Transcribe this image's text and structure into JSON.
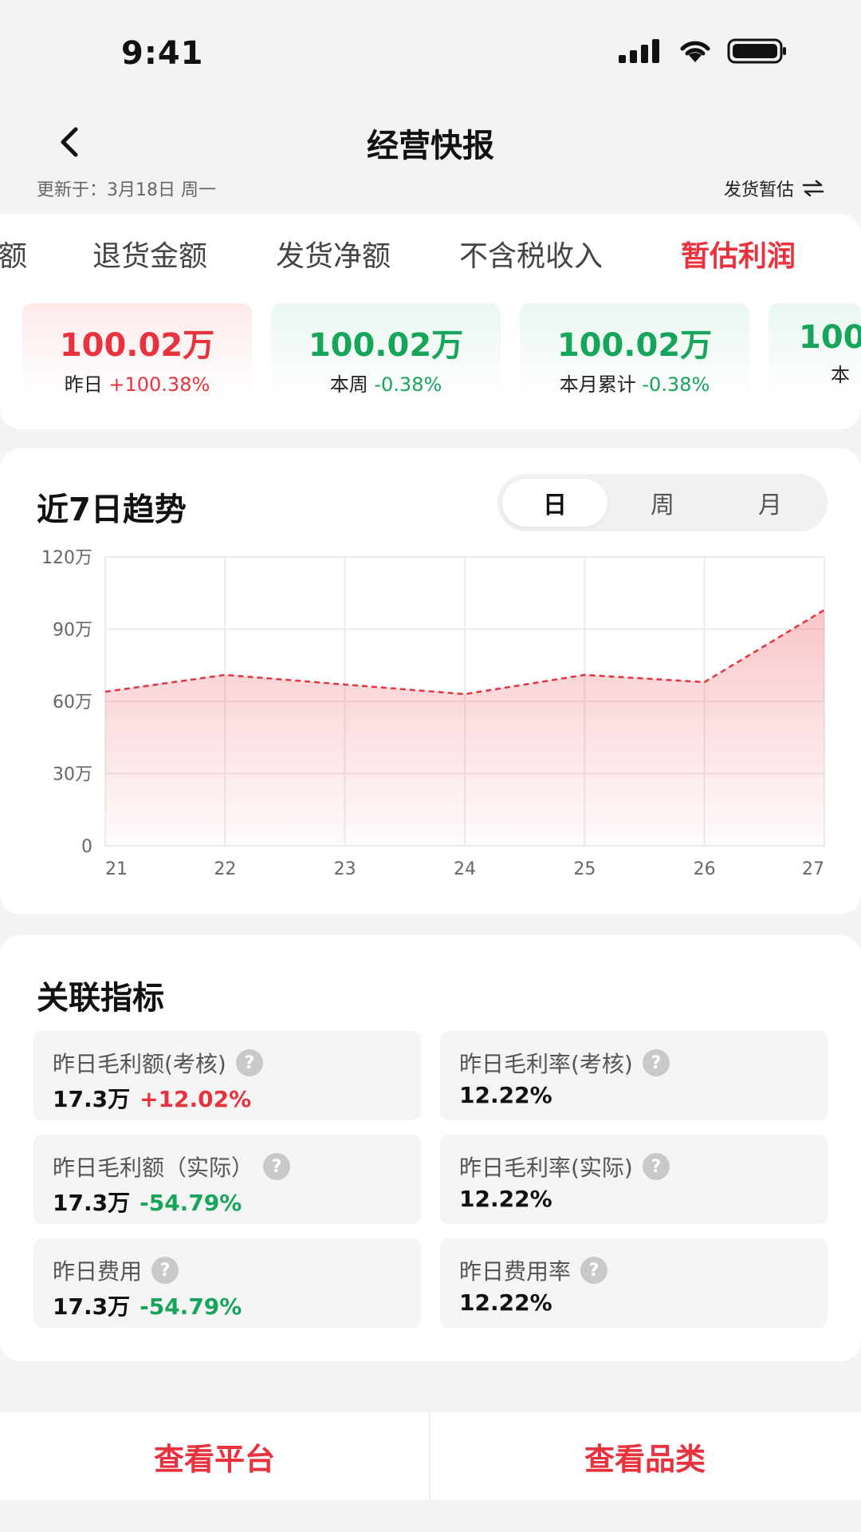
{
  "status_bar": {
    "time": "9:41"
  },
  "nav": {
    "title": "经营快报"
  },
  "update": {
    "text": "更新于：3月18日 周一",
    "toggle_label": "发货暂估"
  },
  "tabs": [
    {
      "label": "金额"
    },
    {
      "label": "退货金额"
    },
    {
      "label": "发货净额"
    },
    {
      "label": "不含税收入"
    },
    {
      "label": "暂估利润"
    }
  ],
  "active_tab": "暂估利润",
  "metrics": [
    {
      "value": "100.02万",
      "label": "昨日",
      "change": "+100.38%",
      "trend": "up"
    },
    {
      "value": "100.02万",
      "label": "本周",
      "change": "-0.38%",
      "trend": "down"
    },
    {
      "value": "100.02万",
      "label": "本月累计",
      "change": "-0.38%",
      "trend": "down"
    },
    {
      "value": "100",
      "label": "本",
      "change": "",
      "trend": "down"
    }
  ],
  "trend": {
    "title": "近7日趋势",
    "segments": [
      "日",
      "周",
      "月"
    ],
    "active_segment": "日"
  },
  "chart_data": {
    "type": "area",
    "x": [
      "21",
      "22",
      "23",
      "24",
      "25",
      "26",
      "27"
    ],
    "values": [
      64,
      71,
      67,
      63,
      71,
      68,
      98
    ],
    "ylim": [
      0,
      120
    ],
    "yticks": [
      "0",
      "30万",
      "60万",
      "90万",
      "120万"
    ],
    "ytick_values": [
      0,
      30,
      60,
      90,
      120
    ],
    "grid": true,
    "line_color": "#e8323e",
    "line_style": "dashed"
  },
  "related": {
    "title": "关联指标",
    "items": [
      {
        "label": "昨日毛利额(考核)",
        "value": "17.3万",
        "change": "+12.02%",
        "trend": "up"
      },
      {
        "label": "昨日毛利率(考核)",
        "value": "12.22%",
        "change": "",
        "trend": ""
      },
      {
        "label": "昨日毛利额（实际）",
        "value": "17.3万",
        "change": "-54.79%",
        "trend": "down"
      },
      {
        "label": "昨日毛利率(实际)",
        "value": "12.22%",
        "change": "",
        "trend": ""
      },
      {
        "label": "昨日费用",
        "value": "17.3万",
        "change": "-54.79%",
        "trend": "down"
      },
      {
        "label": "昨日费用率",
        "value": "12.22%",
        "change": "",
        "trend": ""
      }
    ]
  },
  "bottom": {
    "left_label": "查看平台",
    "right_label": "查看品类"
  },
  "colors": {
    "accent": "#e8323e",
    "positive": "#16a55b"
  }
}
